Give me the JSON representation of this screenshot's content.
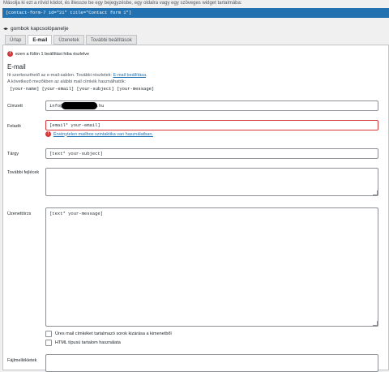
{
  "hint": "Másolja ki ezt a rövid kódot, és illessze be egy bejegyzésbe, egy oldalra vagy egy szöveges widget tartalmába:",
  "shortcode": "[contact-form-7 id=\"21\" title=\"Contact form 1\"]",
  "toggle": {
    "icon": "◂▸",
    "label": "gombok kapcsolópanelje"
  },
  "tabs": [
    {
      "label": "Űrlap"
    },
    {
      "label": "E-mail"
    },
    {
      "label": "Üzenetek"
    },
    {
      "label": "További beállítások"
    }
  ],
  "tab_error": {
    "icon": "!",
    "text": "ezen a fülön 1 beállítási hiba észlelve"
  },
  "section": {
    "title": "E-mail",
    "desc_prefix": "Itt szerkeszthető az e-mail-sablon. További részletek:",
    "desc_link": "E-mail beállítása",
    "desc_suffix": ".",
    "tags_intro": "A következő mezőkben az alábbi mail címkék használhatók:",
    "tags": "[your-name] [your-email] [your-subject] [your-message]"
  },
  "fields": {
    "to": {
      "label": "Címzett",
      "value_start": "info@",
      "value_end": ".hu"
    },
    "from": {
      "label": "Feladó",
      "value": "[email* your-email]",
      "error": "Érvénytelen mailbox szintaktika van használatban.",
      "error_icon": "!"
    },
    "subject": {
      "label": "Tárgy",
      "value": "[text* your-subject]"
    },
    "headers": {
      "label": "További fejlécek",
      "value": ""
    },
    "body": {
      "label": "Üzenettörzs",
      "value": "[text* your-message]"
    },
    "attachments": {
      "label": "Fájlmellékletek"
    }
  },
  "options": {
    "exclude_blank": "Üres mail címkéket tartalmazó sorok kizárása a kimenetből",
    "use_html": "HTML típusú tartalom használata"
  }
}
